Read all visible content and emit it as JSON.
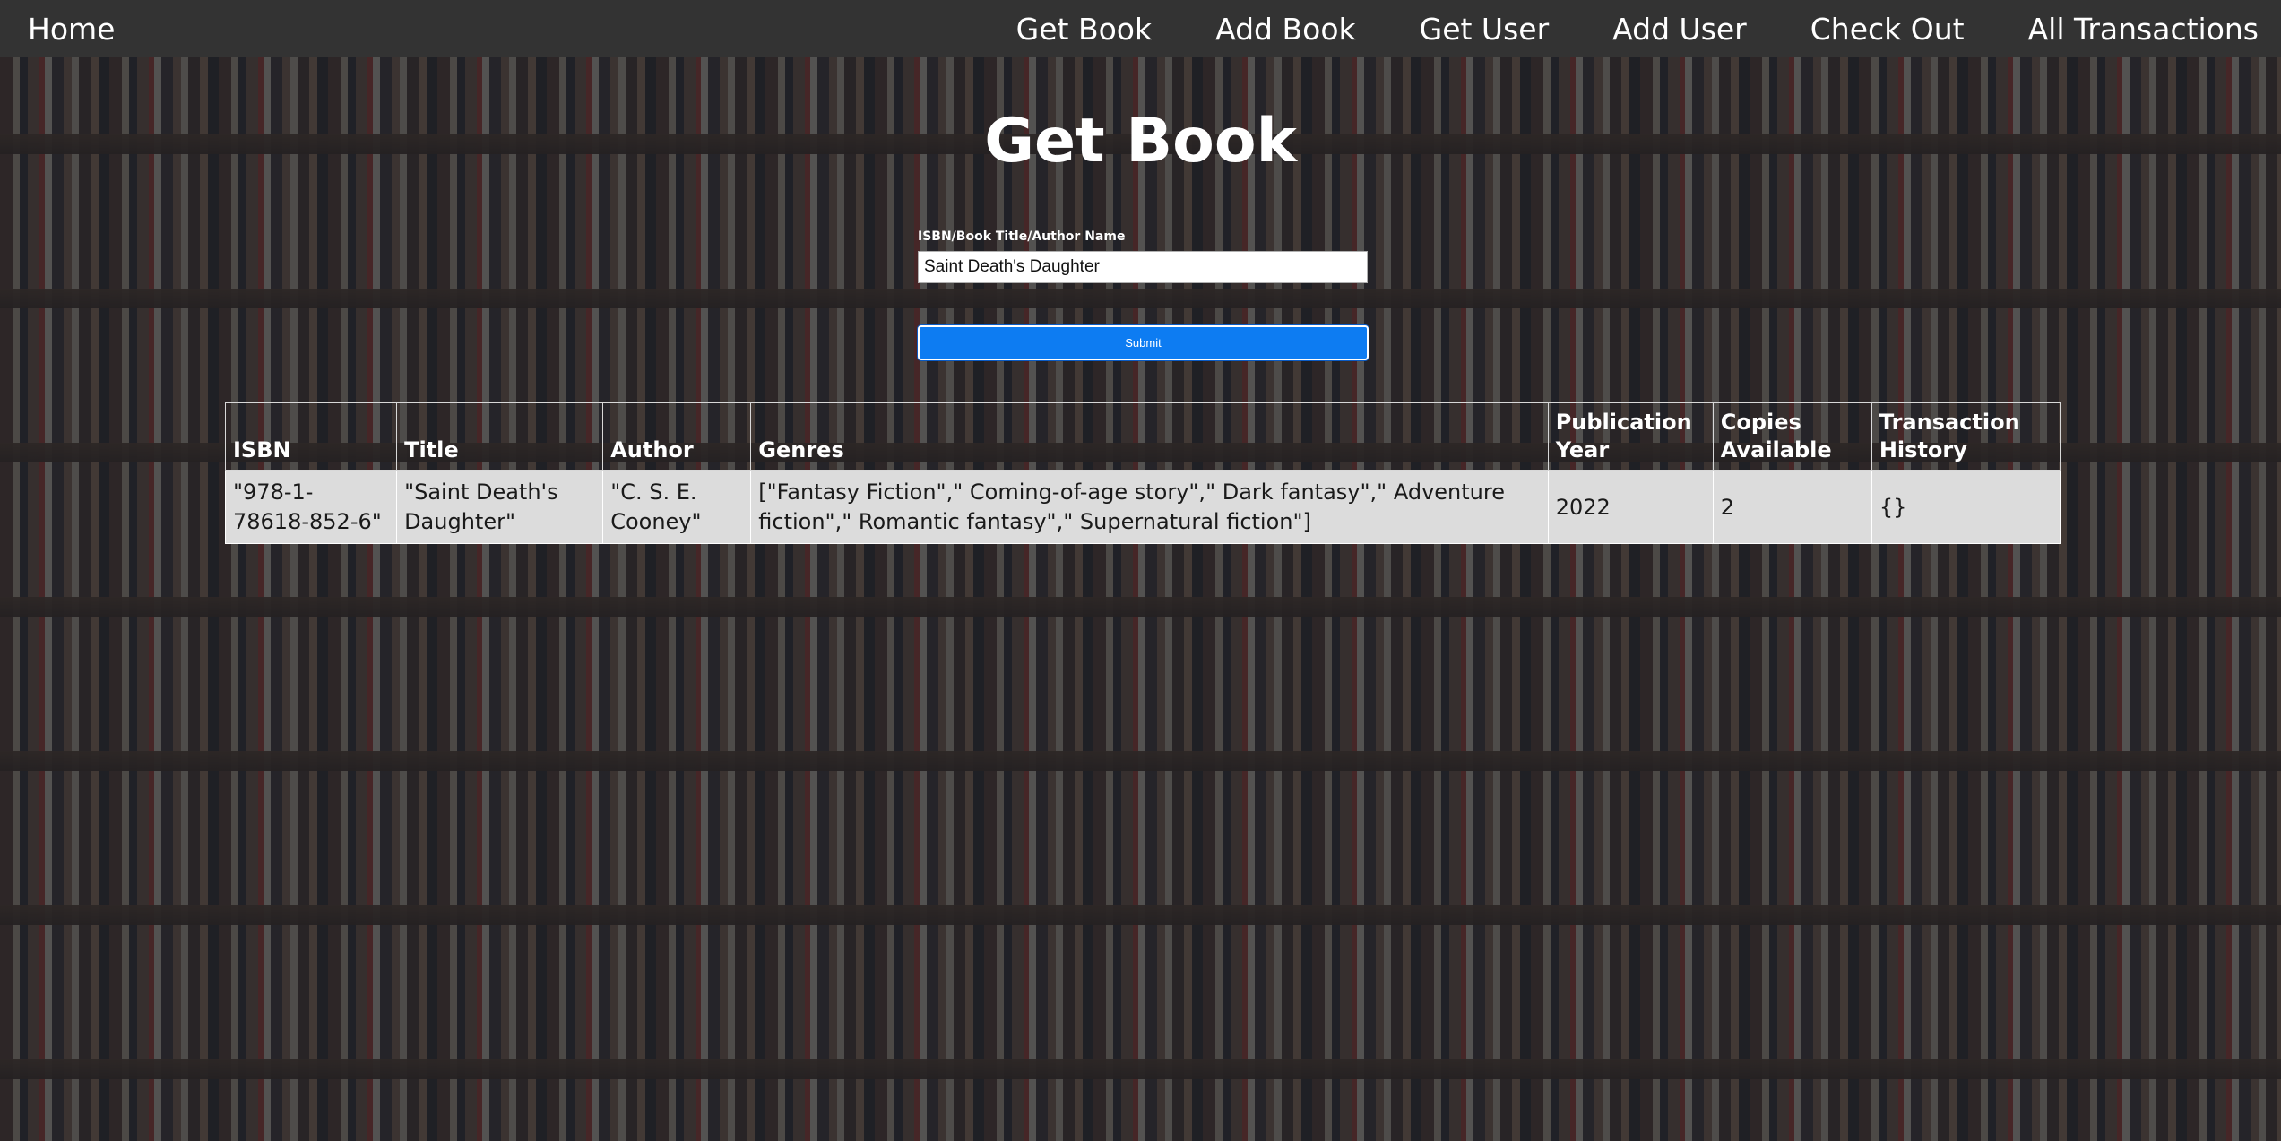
{
  "nav": {
    "home": "Home",
    "links": [
      "Get Book",
      "Add Book",
      "Get User",
      "Add User",
      "Check Out",
      "All Transactions"
    ]
  },
  "page": {
    "title": "Get Book"
  },
  "form": {
    "label": "ISBN/Book Title/Author Name",
    "value": "Saint Death's Daughter",
    "submit_label": "Submit"
  },
  "table": {
    "headers": [
      "ISBN",
      "Title",
      "Author",
      "Genres",
      "Publication Year",
      "Copies Available",
      "Transaction History"
    ],
    "rows": [
      [
        "\"978-1-78618-852-6\"",
        "\"Saint Death's Daughter\"",
        "\"C. S. E. Cooney\"",
        "[\"Fantasy Fiction\",\" Coming-of-age story\",\" Dark fantasy\",\" Adventure fiction\",\" Romantic fantasy\",\" Supernatural fiction\"]",
        "2022",
        "2",
        "{}"
      ]
    ]
  },
  "colors": {
    "navbar": "#333333",
    "submit_button": "#0d7cf2",
    "row_background": "#dcdcdc"
  }
}
